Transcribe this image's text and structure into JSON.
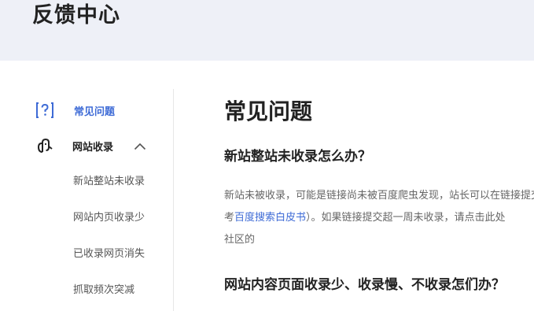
{
  "header": {
    "title": "反馈中心"
  },
  "sidebar": {
    "faq_label": "常见问题",
    "index_label": "网站收录",
    "sub_items": [
      "新站整站未收录",
      "网站内页收录少",
      "已收录网页消失",
      "抓取频次突减"
    ]
  },
  "main": {
    "title": "常见问题",
    "question1": "新站整站未收录怎么办？",
    "answer1_line1": "新站未被收录，可能是链接尚未被百度爬虫发现，站长可以在链接提交",
    "answer1_line2_prefix": "考",
    "answer1_link": "百度搜索白皮书",
    "answer1_line2_suffix": "）。如果链接提交超一周未收录，请点击此处",
    "answer1_line3": "社区的",
    "question2": "网站内容页面收录少、收录慢、不收录怎们办？"
  },
  "colors": {
    "accent": "#3e6bd6",
    "header_bg": "#eef0f7"
  },
  "icons": {
    "faq": "question-mark-icon",
    "index": "spider-icon",
    "collapse": "chevron-up-icon"
  }
}
